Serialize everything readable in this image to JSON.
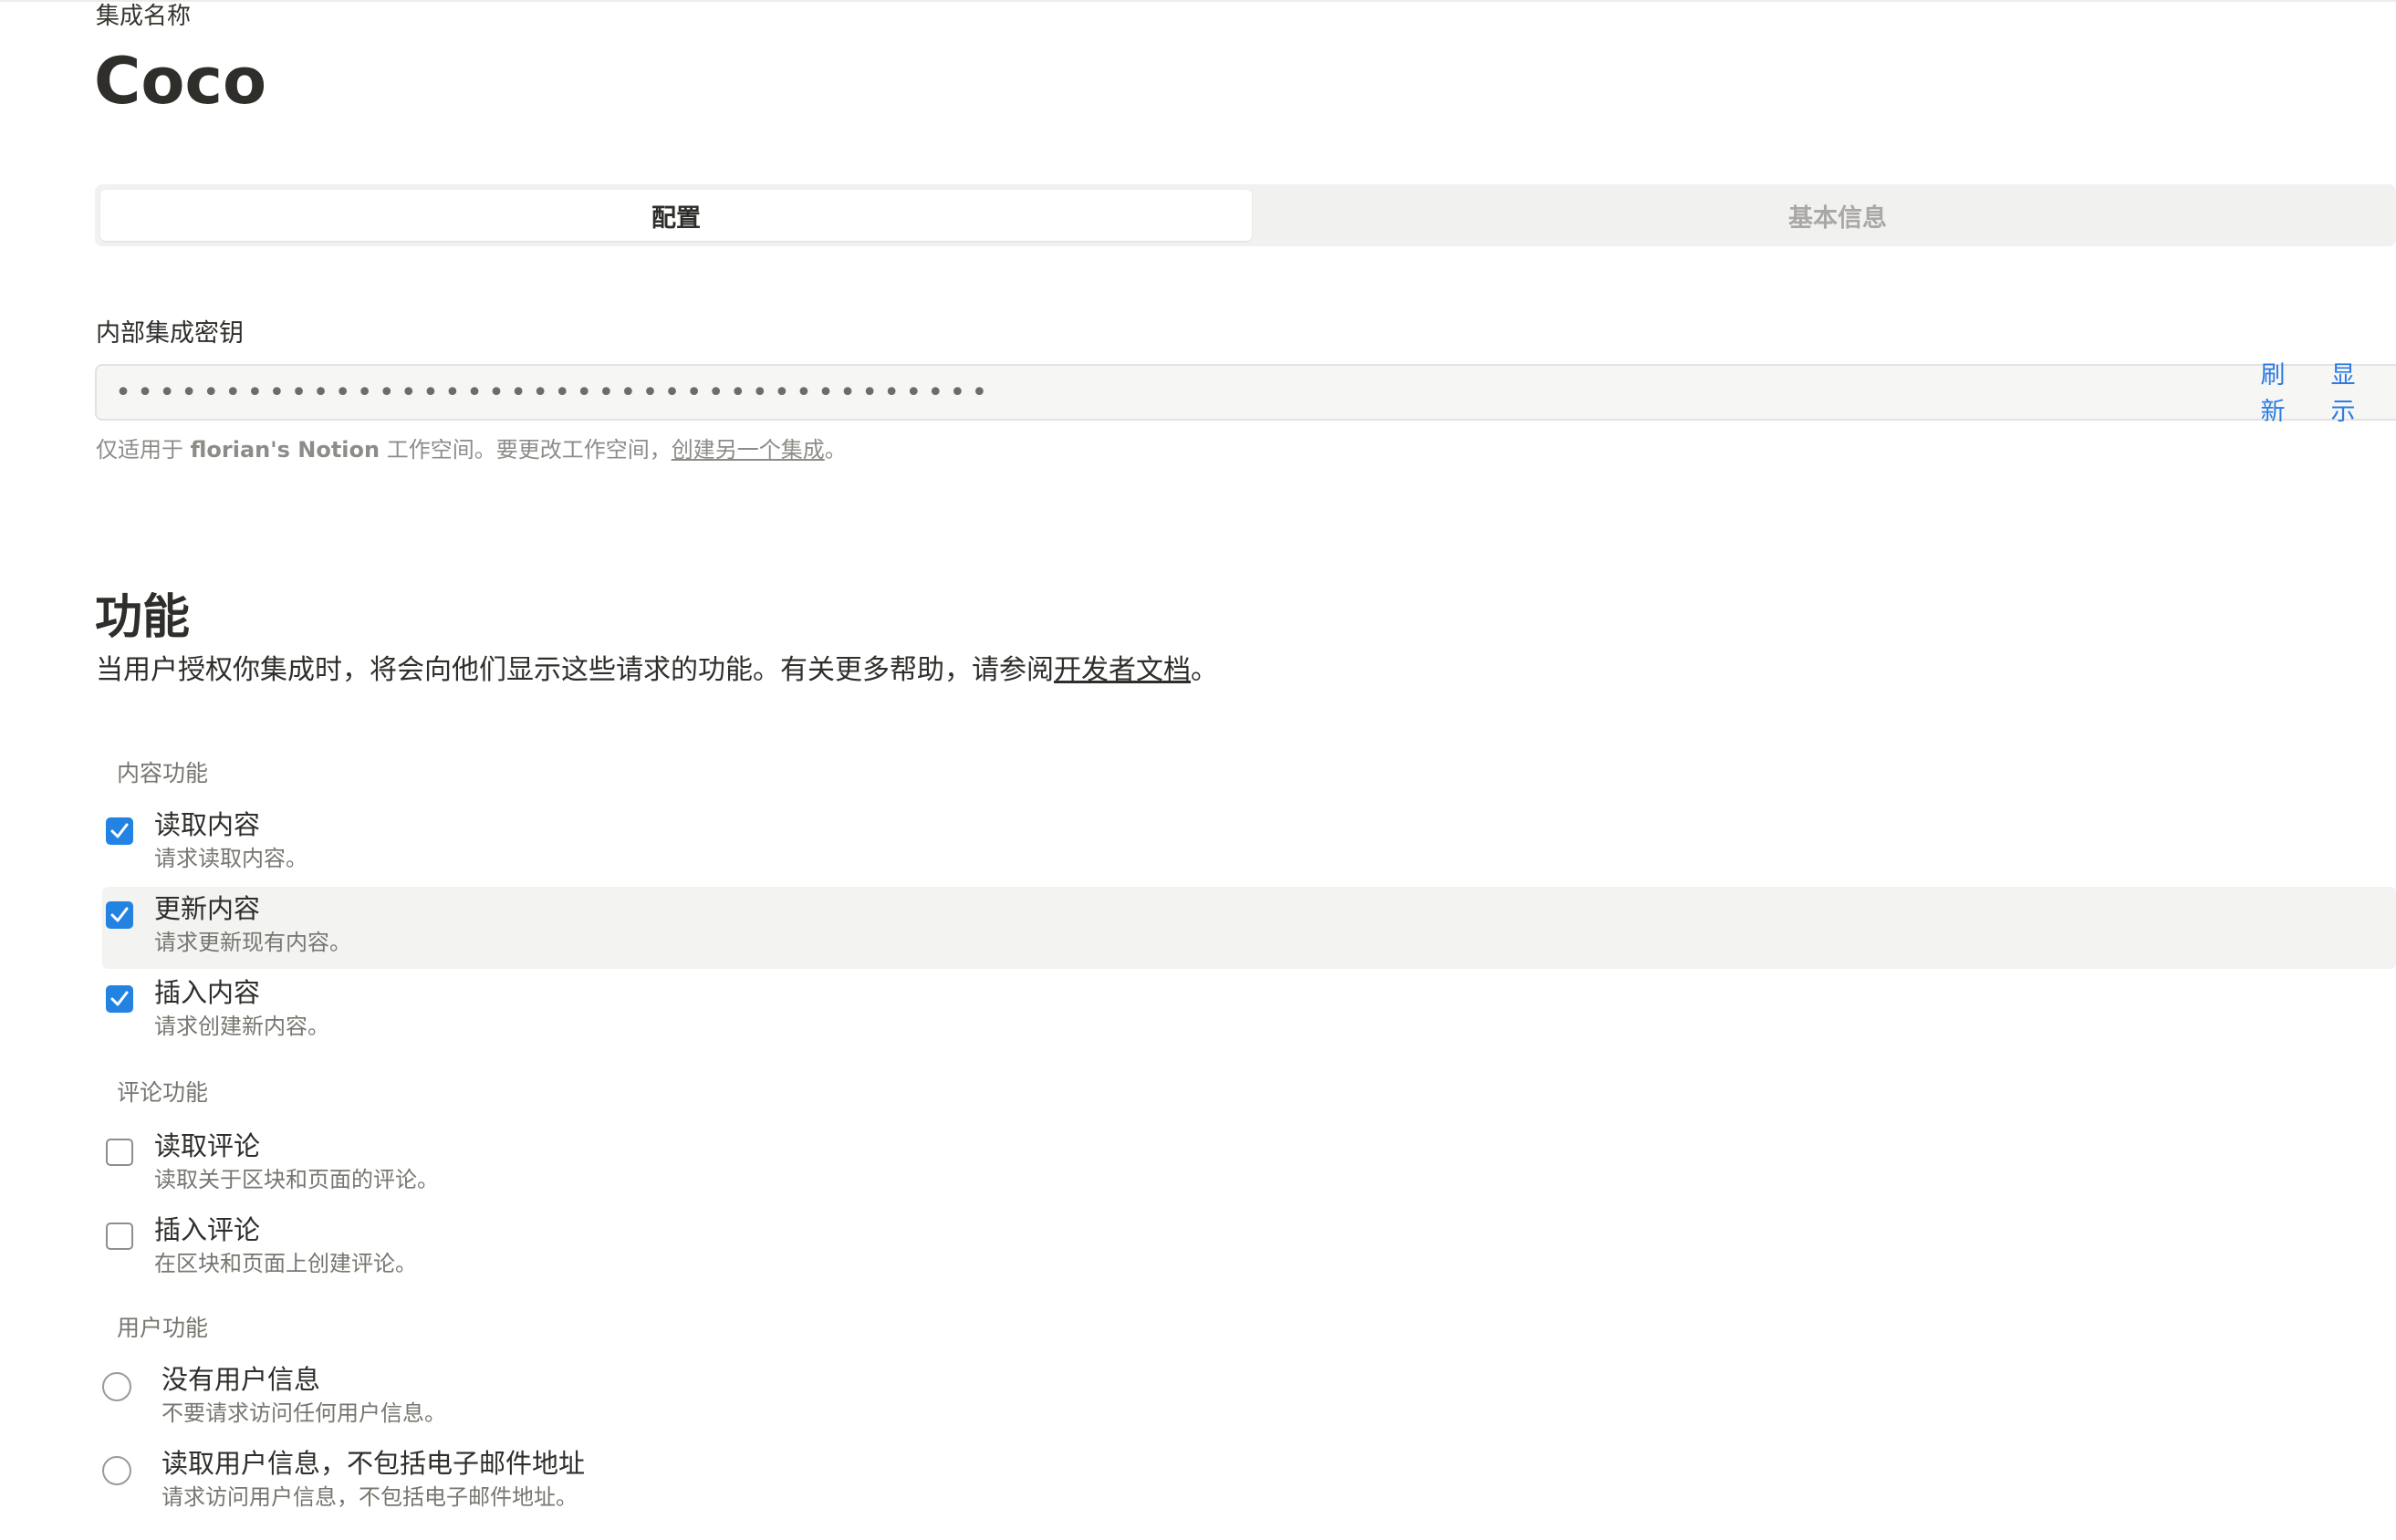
{
  "header": {
    "name_label": "集成名称",
    "app_title": "Coco"
  },
  "tabs": [
    {
      "label": "配置",
      "active": true
    },
    {
      "label": "基本信息",
      "active": false
    }
  ],
  "secret": {
    "label": "内部集成密钥",
    "masked_value": "••••••••••••••••••••••••••••••••••••••••",
    "refresh_label": "刷新",
    "show_label": "显示",
    "helper_prefix": "仅适用于 ",
    "helper_workspace": "florian's Notion",
    "helper_middle": " 工作空间。要更改工作空间，",
    "helper_link": "创建另一个集成",
    "helper_suffix": "。"
  },
  "capabilities": {
    "title": "功能",
    "desc_prefix": "当用户授权你集成时，将会向他们显示这些请求的功能。有关更多帮助，请参阅",
    "desc_link": "开发者文档",
    "desc_suffix": "。",
    "content_group": {
      "label": "内容功能",
      "items": [
        {
          "title": "读取内容",
          "desc": "请求读取内容。",
          "checked": true
        },
        {
          "title": "更新内容",
          "desc": "请求更新现有内容。",
          "checked": true
        },
        {
          "title": "插入内容",
          "desc": "请求创建新内容。",
          "checked": true
        }
      ]
    },
    "comment_group": {
      "label": "评论功能",
      "items": [
        {
          "title": "读取评论",
          "desc": "读取关于区块和页面的评论。",
          "checked": false
        },
        {
          "title": "插入评论",
          "desc": "在区块和页面上创建评论。",
          "checked": false
        }
      ]
    },
    "user_group": {
      "label": "用户功能",
      "items": [
        {
          "title": "没有用户信息",
          "desc": "不要请求访问任何用户信息。",
          "selected": false
        },
        {
          "title": "读取用户信息，不包括电子邮件地址",
          "desc": "请求访问用户信息，不包括电子邮件地址。",
          "selected": false
        }
      ]
    }
  },
  "colors": {
    "accent": "#2383e2",
    "link_blue": "#2c7be5",
    "text_primary": "#2f2e2b",
    "text_secondary": "#77766f",
    "highlight_row": "#f3f3f1"
  }
}
